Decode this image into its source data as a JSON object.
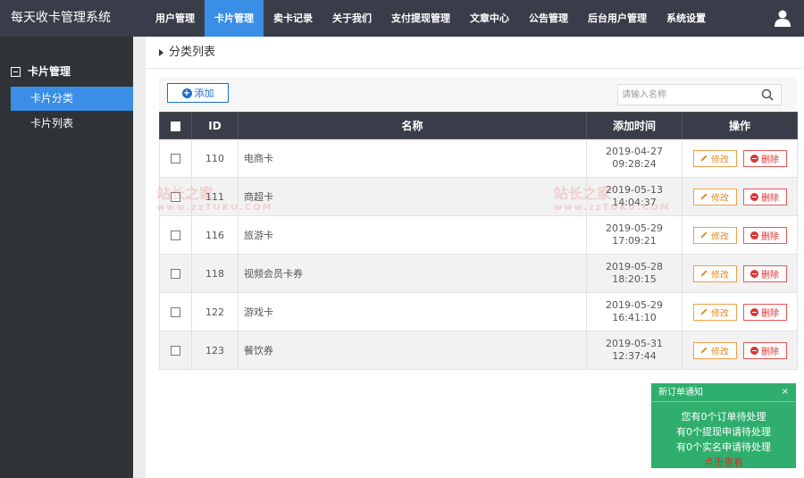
{
  "header": {
    "brand": "每天收卡管理系统",
    "nav": [
      "用户管理",
      "卡片管理",
      "卖卡记录",
      "关于我们",
      "支付提现管理",
      "文章中心",
      "公告管理",
      "后台用户管理",
      "系统设置"
    ],
    "active_nav": "卡片管理",
    "user_icon": "user-icon"
  },
  "sidebar": {
    "section": "卡片管理",
    "items": [
      "卡片分类",
      "卡片列表"
    ],
    "active": "卡片分类"
  },
  "page": {
    "title": "分类列表"
  },
  "toolbar": {
    "add_label": "添加",
    "search_placeholder": "请输入名称"
  },
  "table": {
    "headers": [
      "ID",
      "名称",
      "添加时间",
      "操作"
    ],
    "edit_label": "修改",
    "delete_label": "删除",
    "rows": [
      {
        "id": "110",
        "name": "电商卡",
        "date": "2019-04-27",
        "time": "09:28:24"
      },
      {
        "id": "111",
        "name": "商超卡",
        "date": "2019-05-13",
        "time": "14:04:37"
      },
      {
        "id": "116",
        "name": "旅游卡",
        "date": "2019-05-29",
        "time": "17:09:21"
      },
      {
        "id": "118",
        "name": "视频会员卡券",
        "date": "2019-05-28",
        "time": "18:20:15"
      },
      {
        "id": "122",
        "name": "游戏卡",
        "date": "2019-05-29",
        "time": "16:41:10"
      },
      {
        "id": "123",
        "name": "餐饮券",
        "date": "2019-05-31",
        "time": "12:37:44"
      }
    ]
  },
  "watermark": {
    "text": "站长之家",
    "url": "www.zzTUKU.COM"
  },
  "notify": {
    "title": "新订单通知",
    "close": "×",
    "lines": [
      "您有0个订单待处理",
      "有0个提现申请待处理",
      "有0个实名申请待处理"
    ],
    "link": "点击查看"
  },
  "colors": {
    "topbar": "#393d49",
    "sidebar": "#2f3237",
    "accent": "#3a8ee6",
    "notify": "#2fae6d"
  }
}
